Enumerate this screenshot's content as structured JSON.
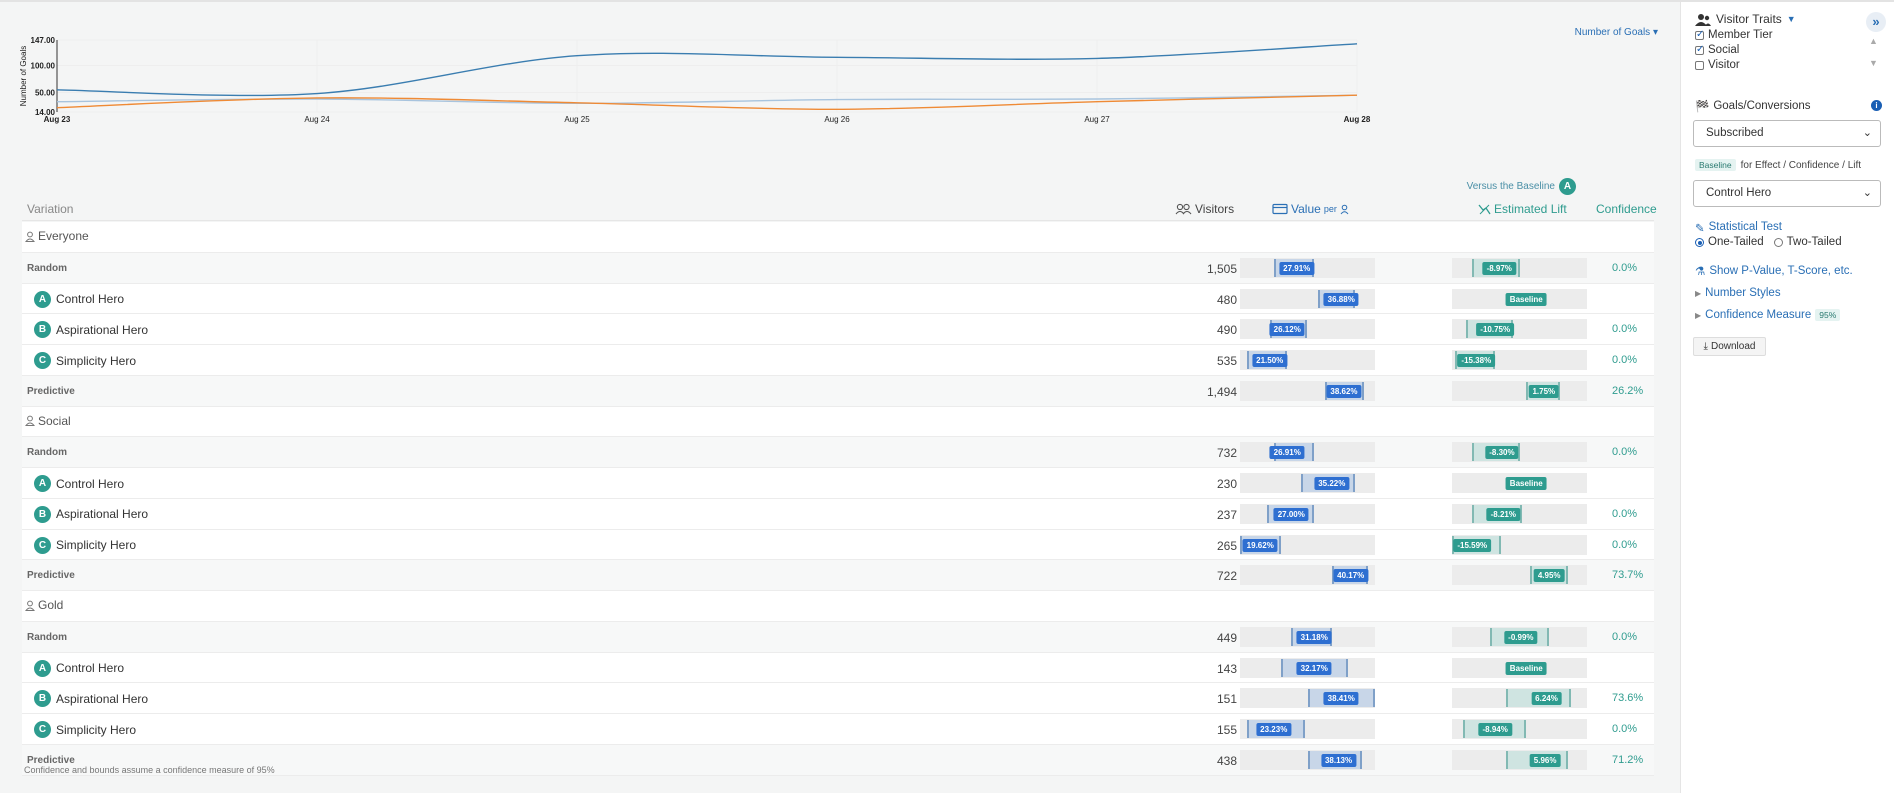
{
  "chart_data": {
    "type": "line",
    "ylabel": "Number of Goals",
    "yticks": [
      "14.00",
      "50.00",
      "100.00",
      "147.00"
    ],
    "ylim": [
      14,
      147
    ],
    "categories": [
      "Aug 23",
      "Aug 24",
      "Aug 25",
      "Aug 26",
      "Aug 27",
      "Aug 28"
    ],
    "grid": true,
    "series": [
      {
        "values": [
          55,
          48,
          118,
          115,
          113,
          140
        ],
        "color": "#3a7db0"
      },
      {
        "values": [
          22,
          40,
          31,
          19,
          33,
          45
        ],
        "color": "#ef8a35"
      },
      {
        "values": [
          33,
          38,
          30,
          37,
          38,
          45
        ],
        "color": "#a8c4de"
      }
    ]
  },
  "metric_dropdown": "Number of Goals",
  "versus_label": "Versus the Baseline",
  "versus_badge": "A",
  "headers": {
    "variation": "Variation",
    "visitors": "Visitors",
    "value": "Value",
    "value_per": "per",
    "lift": "Estimated Lift",
    "confidence": "Confidence"
  },
  "rows": [
    {
      "type": "seg",
      "label": "Everyone"
    },
    {
      "type": "group",
      "label": "Random",
      "visitors": "1,505",
      "val": {
        "text": "27.91%",
        "pos": 0.42,
        "lo": 0.25,
        "hi": 0.55
      },
      "lift": {
        "text": "-8.97%",
        "pos": 0.35,
        "lo": 0.15,
        "hi": 0.5,
        "baseline": false
      },
      "conf": "0.0%"
    },
    {
      "type": "variant",
      "badge": "A",
      "label": "Control Hero",
      "visitors": "480",
      "val": {
        "text": "36.88%",
        "pos": 0.75,
        "lo": 0.58,
        "hi": 0.85
      },
      "lift": {
        "text": "Baseline",
        "pos": 0.55,
        "baseline": true
      },
      "conf": ""
    },
    {
      "type": "variant",
      "badge": "B",
      "label": "Aspirational Hero",
      "visitors": "490",
      "val": {
        "text": "26.12%",
        "pos": 0.35,
        "lo": 0.22,
        "hi": 0.5
      },
      "lift": {
        "text": "-10.75%",
        "pos": 0.32,
        "lo": 0.1,
        "hi": 0.45,
        "baseline": false
      },
      "conf": "0.0%"
    },
    {
      "type": "variant",
      "badge": "C",
      "label": "Simplicity Hero",
      "visitors": "535",
      "val": {
        "text": "21.50%",
        "pos": 0.22,
        "lo": 0.05,
        "hi": 0.35
      },
      "lift": {
        "text": "-15.38%",
        "pos": 0.18,
        "lo": 0.02,
        "hi": 0.32,
        "baseline": false
      },
      "conf": "0.0%"
    },
    {
      "type": "group",
      "label": "Predictive",
      "visitors": "1,494",
      "val": {
        "text": "38.62%",
        "pos": 0.77,
        "lo": 0.63,
        "hi": 0.92
      },
      "lift": {
        "text": "1.75%",
        "pos": 0.68,
        "lo": 0.55,
        "hi": 0.8,
        "baseline": false
      },
      "conf": "26.2%"
    },
    {
      "type": "seg",
      "label": "Social"
    },
    {
      "type": "group",
      "label": "Random",
      "visitors": "732",
      "val": {
        "text": "26.91%",
        "pos": 0.35,
        "lo": 0.25,
        "hi": 0.55
      },
      "lift": {
        "text": "-8.30%",
        "pos": 0.37,
        "lo": 0.15,
        "hi": 0.5,
        "baseline": false
      },
      "conf": "0.0%"
    },
    {
      "type": "variant",
      "badge": "A",
      "label": "Control Hero",
      "visitors": "230",
      "val": {
        "text": "35.22%",
        "pos": 0.68,
        "lo": 0.45,
        "hi": 0.85
      },
      "lift": {
        "text": "Baseline",
        "pos": 0.55,
        "baseline": true
      },
      "conf": ""
    },
    {
      "type": "variant",
      "badge": "B",
      "label": "Aspirational Hero",
      "visitors": "237",
      "val": {
        "text": "27.00%",
        "pos": 0.38,
        "lo": 0.2,
        "hi": 0.55
      },
      "lift": {
        "text": "-8.21%",
        "pos": 0.38,
        "lo": 0.15,
        "hi": 0.52,
        "baseline": false
      },
      "conf": "0.0%"
    },
    {
      "type": "variant",
      "badge": "C",
      "label": "Simplicity Hero",
      "visitors": "265",
      "val": {
        "text": "19.62%",
        "pos": 0.15,
        "lo": 0.0,
        "hi": 0.3
      },
      "lift": {
        "text": "-15.59%",
        "pos": 0.15,
        "lo": 0.0,
        "hi": 0.36,
        "baseline": false
      },
      "conf": "0.0%"
    },
    {
      "type": "group",
      "label": "Predictive",
      "visitors": "722",
      "val": {
        "text": "40.17%",
        "pos": 0.82,
        "lo": 0.68,
        "hi": 0.95
      },
      "lift": {
        "text": "4.95%",
        "pos": 0.72,
        "lo": 0.58,
        "hi": 0.86,
        "baseline": false
      },
      "conf": "73.7%"
    },
    {
      "type": "seg",
      "label": "Gold"
    },
    {
      "type": "group",
      "label": "Random",
      "visitors": "449",
      "val": {
        "text": "31.18%",
        "pos": 0.55,
        "lo": 0.38,
        "hi": 0.68
      },
      "lift": {
        "text": "-0.99%",
        "pos": 0.51,
        "lo": 0.28,
        "hi": 0.72,
        "baseline": false
      },
      "conf": "0.0%"
    },
    {
      "type": "variant",
      "badge": "A",
      "label": "Control Hero",
      "visitors": "143",
      "val": {
        "text": "32.17%",
        "pos": 0.55,
        "lo": 0.3,
        "hi": 0.8
      },
      "lift": {
        "text": "Baseline",
        "pos": 0.55,
        "baseline": true
      },
      "conf": ""
    },
    {
      "type": "variant",
      "badge": "B",
      "label": "Aspirational Hero",
      "visitors": "151",
      "val": {
        "text": "38.41%",
        "pos": 0.75,
        "lo": 0.5,
        "hi": 1.0
      },
      "lift": {
        "text": "6.24%",
        "pos": 0.7,
        "lo": 0.4,
        "hi": 0.88,
        "baseline": false
      },
      "conf": "73.6%"
    },
    {
      "type": "variant",
      "badge": "C",
      "label": "Simplicity Hero",
      "visitors": "155",
      "val": {
        "text": "23.23%",
        "pos": 0.25,
        "lo": 0.05,
        "hi": 0.48
      },
      "lift": {
        "text": "-8.94%",
        "pos": 0.32,
        "lo": 0.08,
        "hi": 0.55,
        "baseline": false
      },
      "conf": "0.0%"
    },
    {
      "type": "group",
      "label": "Predictive",
      "visitors": "438",
      "val": {
        "text": "38.13%",
        "pos": 0.73,
        "lo": 0.5,
        "hi": 0.9
      },
      "lift": {
        "text": "5.96%",
        "pos": 0.69,
        "lo": 0.4,
        "hi": 0.86,
        "baseline": false
      },
      "conf": "71.2%"
    }
  ],
  "footnote": "Confidence and bounds assume a confidence measure of 95%",
  "sidebar": {
    "traits_title": "Visitor Traits",
    "traits": [
      {
        "label": "Member Tier",
        "checked": true
      },
      {
        "label": "Social",
        "checked": true
      },
      {
        "label": "Visitor",
        "checked": false
      }
    ],
    "goals_title": "Goals/Conversions",
    "goal_selected": "Subscribed",
    "baseline_tag": "Baseline",
    "baseline_text": "for Effect / Confidence / Lift",
    "baseline_selected": "Control Hero",
    "stat_test_title": "Statistical Test",
    "one_tailed": "One-Tailed",
    "two_tailed": "Two-Tailed",
    "show_pvalue": "Show P-Value, T-Score, etc.",
    "number_styles": "Number Styles",
    "confidence_measure": "Confidence Measure",
    "confidence_measure_tag": "95%",
    "download": "Download"
  }
}
